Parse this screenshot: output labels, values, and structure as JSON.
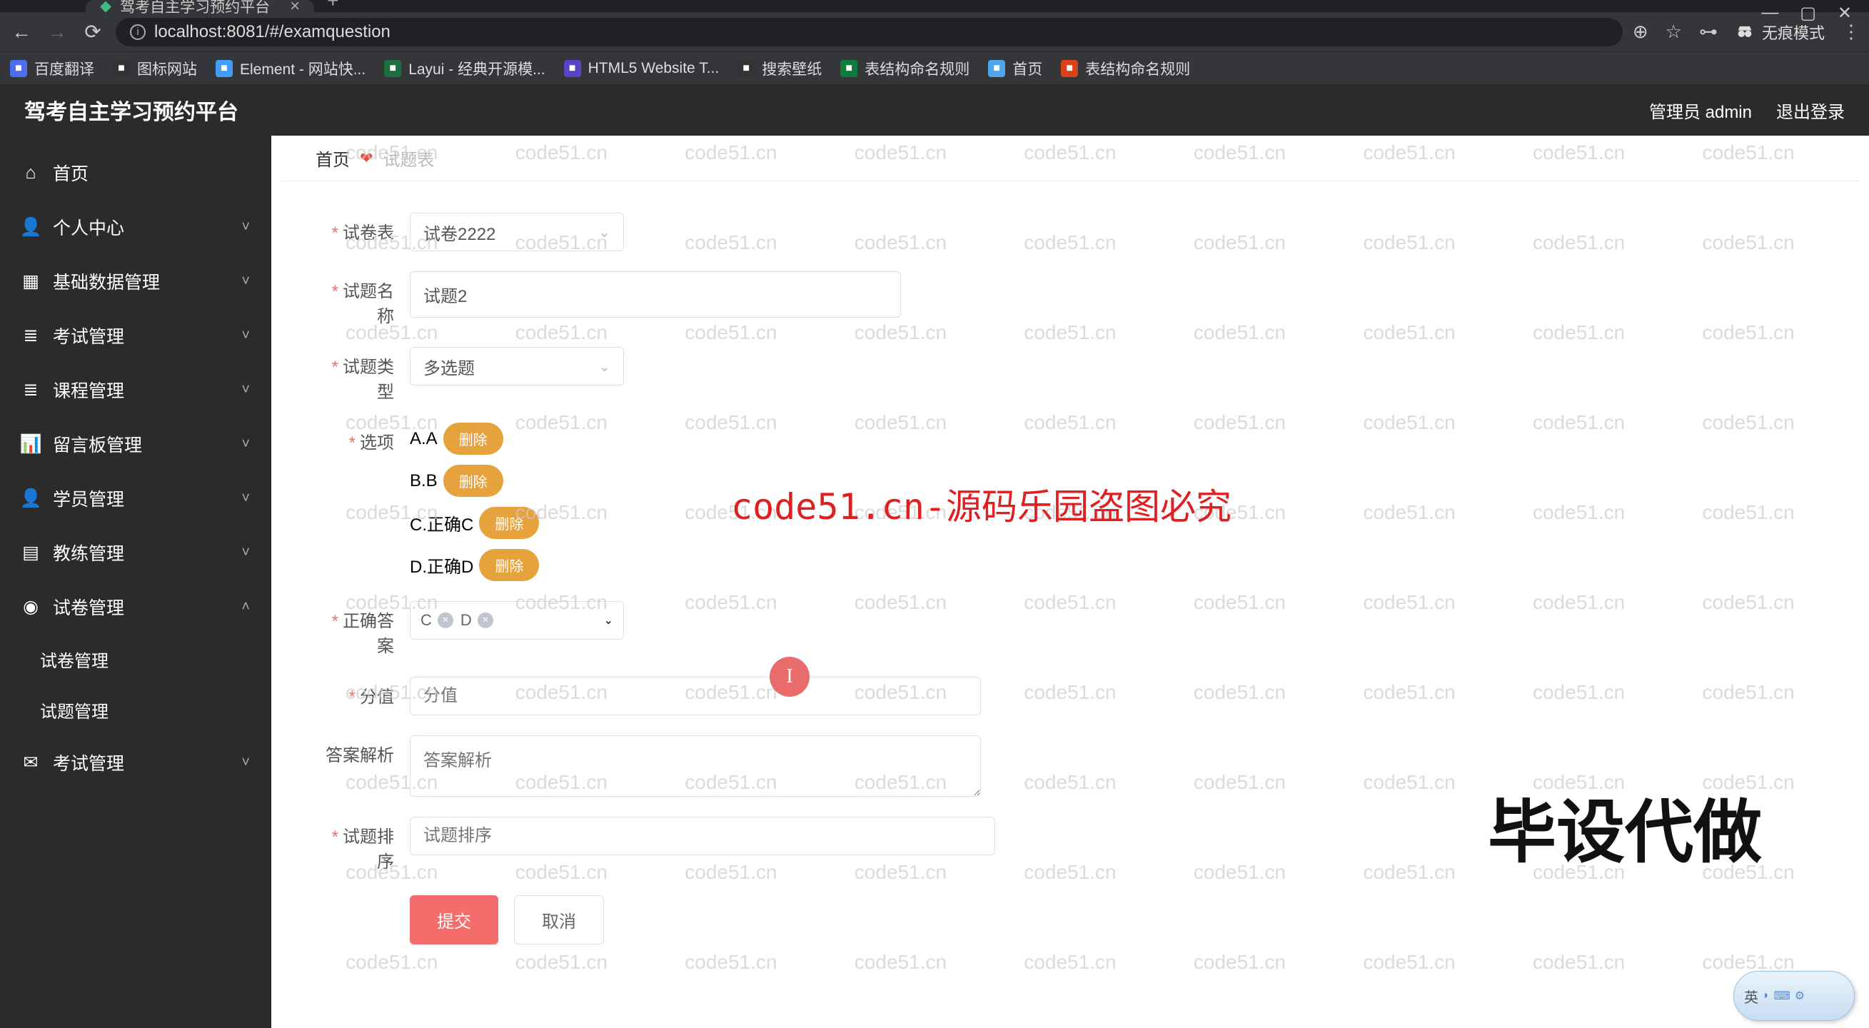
{
  "browser": {
    "tab_title": "驾考自主学习预约平台",
    "url": "localhost:8081/#/examquestion",
    "no_trace": "无痕模式",
    "bookmarks": [
      {
        "label": "百度翻译",
        "color": "#4e6ef2"
      },
      {
        "label": "图标网站",
        "color": "#333"
      },
      {
        "label": "Element - 网站快...",
        "color": "#409eff"
      },
      {
        "label": "Layui - 经典开源模...",
        "color": "#1f6f3e"
      },
      {
        "label": "HTML5 Website T...",
        "color": "#5b43c4"
      },
      {
        "label": "搜索壁纸",
        "color": "#333"
      },
      {
        "label": "表结构命名规则",
        "color": "#0a7d3c"
      },
      {
        "label": "首页",
        "color": "#4fa6ee"
      },
      {
        "label": "表结构命名规则",
        "color": "#d84315"
      }
    ]
  },
  "header": {
    "title": "驾考自主学习预约平台",
    "user": "管理员 admin",
    "logout": "退出登录"
  },
  "sidebar": {
    "items": [
      {
        "icon": "home",
        "label": "首页",
        "expandable": false
      },
      {
        "icon": "user",
        "label": "个人中心",
        "expandable": true,
        "open": false
      },
      {
        "icon": "grid",
        "label": "基础数据管理",
        "expandable": true,
        "open": false
      },
      {
        "icon": "stack",
        "label": "考试管理",
        "expandable": true,
        "open": false
      },
      {
        "icon": "stack",
        "label": "课程管理",
        "expandable": true,
        "open": false
      },
      {
        "icon": "chart",
        "label": "留言板管理",
        "expandable": true,
        "open": false
      },
      {
        "icon": "user",
        "label": "学员管理",
        "expandable": true,
        "open": false
      },
      {
        "icon": "doc",
        "label": "教练管理",
        "expandable": true,
        "open": false
      },
      {
        "icon": "shield",
        "label": "试卷管理",
        "expandable": true,
        "open": true,
        "children": [
          "试卷管理",
          "试题管理"
        ]
      },
      {
        "icon": "mail",
        "label": "考试管理",
        "expandable": true,
        "open": false
      }
    ]
  },
  "crumb": {
    "home": "首页",
    "current": "试题表"
  },
  "form": {
    "labels": {
      "paper": "试卷表",
      "name": "试题名称",
      "type": "试题类型",
      "options": "选项",
      "answer": "正确答案",
      "score": "分值",
      "analysis": "答案解析",
      "order": "试题排序"
    },
    "paper_value": "试卷2222",
    "name_value": "试题2",
    "type_value": "多选题",
    "options": [
      {
        "text": "A.A",
        "del": "删除"
      },
      {
        "text": "B.B",
        "del": "删除"
      },
      {
        "text": "C.正确C",
        "del": "删除"
      },
      {
        "text": "D.正确D",
        "del": "删除"
      }
    ],
    "answer_tags": [
      "C",
      "D"
    ],
    "score_placeholder": "分值",
    "analysis_placeholder": "答案解析",
    "order_placeholder": "试题排序",
    "submit": "提交",
    "cancel": "取消"
  },
  "watermark": {
    "text": "code51.cn",
    "red": "code51.cn-源码乐园盗图必究",
    "big": "毕设代做"
  },
  "ime_lang": "英"
}
